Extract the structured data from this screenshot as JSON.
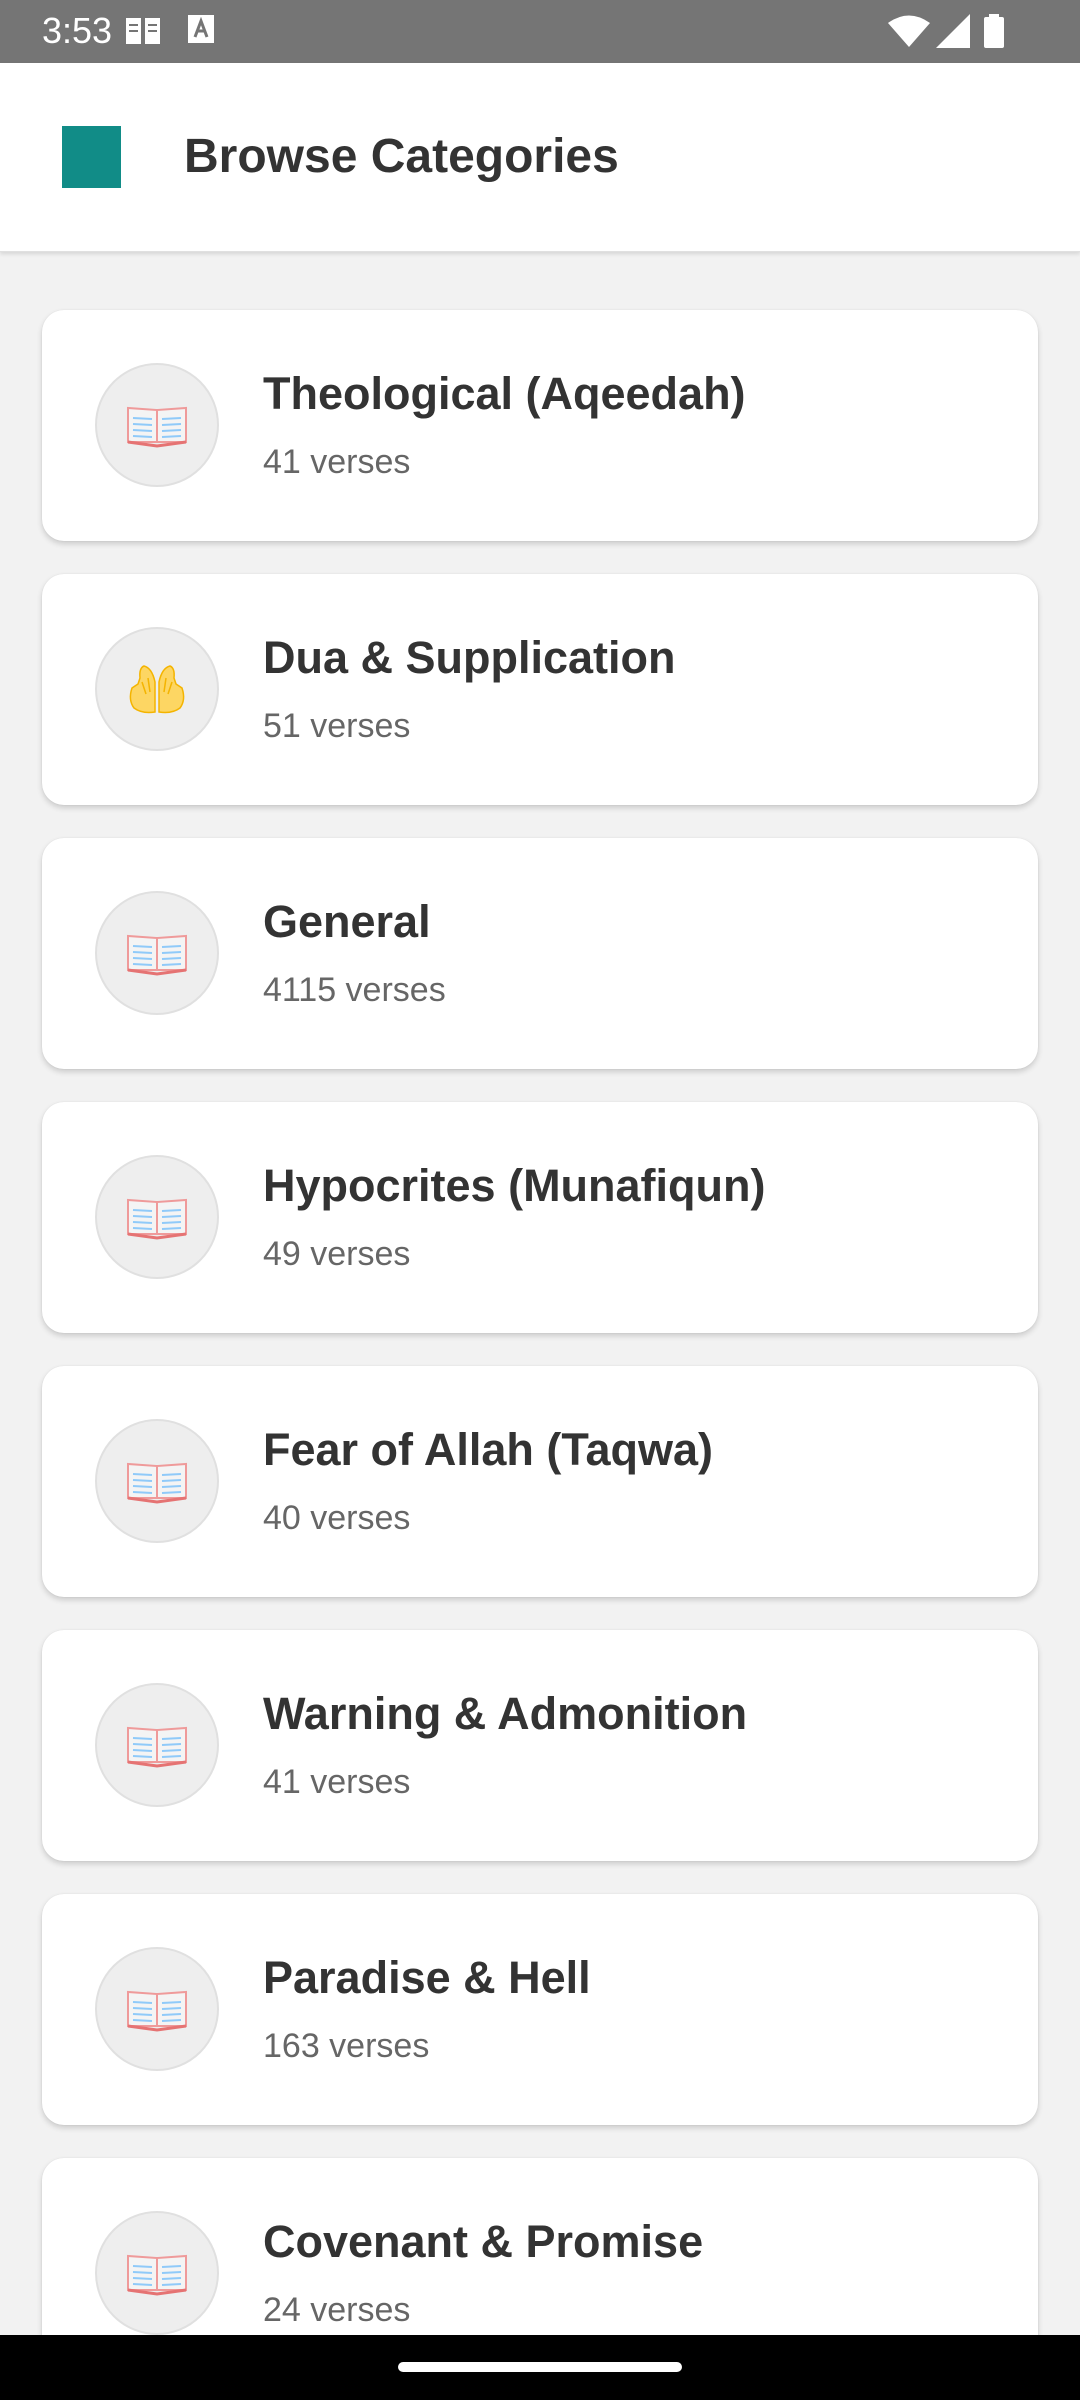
{
  "status_bar": {
    "time": "3:53",
    "icons": [
      "reader-mode-icon",
      "keyboard-a-icon",
      "wifi-icon",
      "cellular-signal-icon",
      "battery-icon"
    ]
  },
  "app_bar": {
    "title": "Browse Categories",
    "logo_color": "#118c87"
  },
  "categories": [
    {
      "title": "Theological (Aqeedah)",
      "count": "41 verses",
      "icon": "open-book-icon"
    },
    {
      "title": "Dua & Supplication",
      "count": "51 verses",
      "icon": "praying-hands-icon"
    },
    {
      "title": "General",
      "count": "4115 verses",
      "icon": "open-book-icon"
    },
    {
      "title": "Hypocrites (Munafiqun)",
      "count": "49 verses",
      "icon": "open-book-icon"
    },
    {
      "title": "Fear of Allah (Taqwa)",
      "count": "40 verses",
      "icon": "open-book-icon"
    },
    {
      "title": "Warning & Admonition",
      "count": "41 verses",
      "icon": "open-book-icon"
    },
    {
      "title": "Paradise & Hell",
      "count": "163 verses",
      "icon": "open-book-icon"
    },
    {
      "title": "Covenant & Promise",
      "count": "24 verses",
      "icon": "open-book-icon"
    }
  ]
}
